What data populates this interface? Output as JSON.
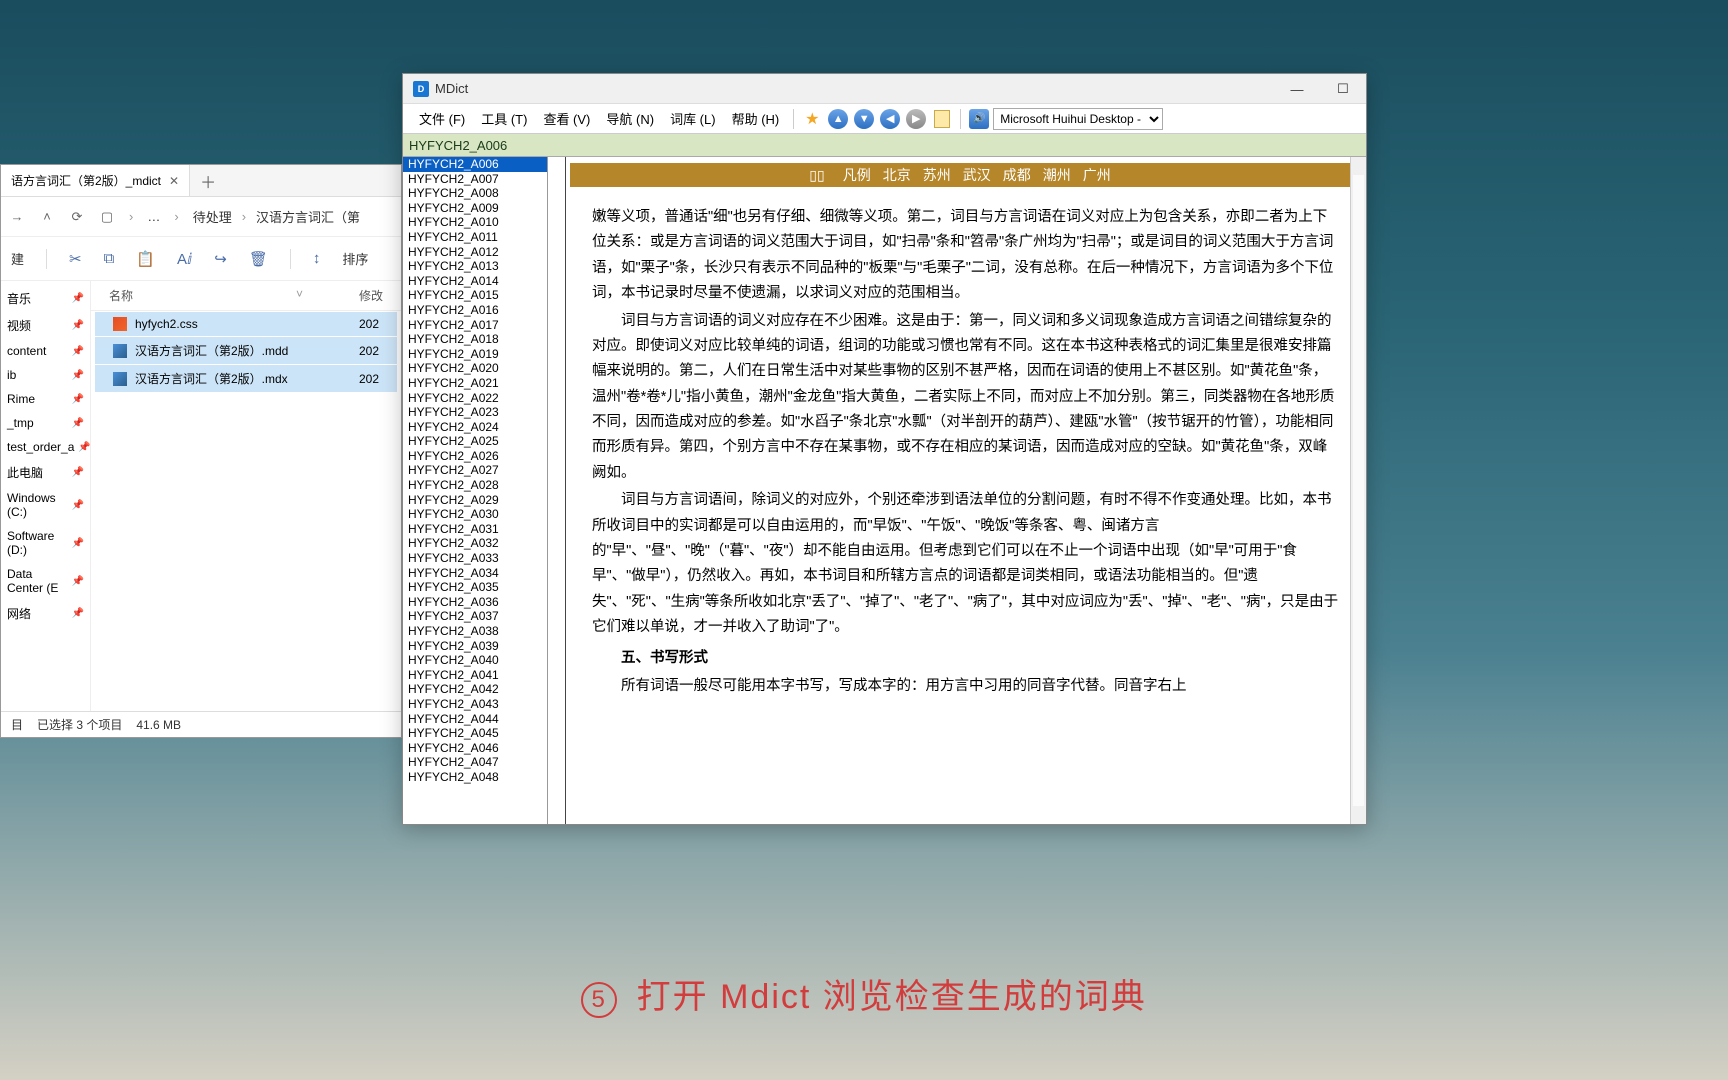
{
  "explorer": {
    "tab_title": "语方言词汇（第2版）_mdict",
    "breadcrumb": {
      "item1": "待处理",
      "item2": "汉语方言词汇（第"
    },
    "new_label": "建",
    "sort_label": "排序",
    "sidebar": {
      "items": [
        "音乐",
        "视频",
        "content",
        "ib",
        "Rime",
        "_tmp",
        "test_order_a",
        "此电脑",
        "Windows (C:)",
        "Software (D:)",
        "Data Center (E",
        "网络"
      ]
    },
    "columns": {
      "name": "名称",
      "date": "修改"
    },
    "files": [
      {
        "name": "hyfych2.css",
        "date": "202",
        "cls": "file-css"
      },
      {
        "name": "汉语方言词汇（第2版）.mdd",
        "date": "202",
        "cls": "file-mdd"
      },
      {
        "name": "汉语方言词汇（第2版）.mdx",
        "date": "202",
        "cls": "file-mdx"
      }
    ],
    "status": {
      "count": "目",
      "sel": "已选择 3 个项目",
      "size": "41.6 MB"
    }
  },
  "mdict": {
    "title": "MDict",
    "menus": [
      "文件 (F)",
      "工具 (T)",
      "查看 (V)",
      "导航 (N)",
      "词库 (L)",
      "帮助 (H)"
    ],
    "tts": "Microsoft Huihui Desktop - C",
    "search": "HYFYCH2_A006",
    "entries": [
      "HYFYCH2_A006",
      "HYFYCH2_A007",
      "HYFYCH2_A008",
      "HYFYCH2_A009",
      "HYFYCH2_A010",
      "HYFYCH2_A011",
      "HYFYCH2_A012",
      "HYFYCH2_A013",
      "HYFYCH2_A014",
      "HYFYCH2_A015",
      "HYFYCH2_A016",
      "HYFYCH2_A017",
      "HYFYCH2_A018",
      "HYFYCH2_A019",
      "HYFYCH2_A020",
      "HYFYCH2_A021",
      "HYFYCH2_A022",
      "HYFYCH2_A023",
      "HYFYCH2_A024",
      "HYFYCH2_A025",
      "HYFYCH2_A026",
      "HYFYCH2_A027",
      "HYFYCH2_A028",
      "HYFYCH2_A029",
      "HYFYCH2_A030",
      "HYFYCH2_A031",
      "HYFYCH2_A032",
      "HYFYCH2_A033",
      "HYFYCH2_A034",
      "HYFYCH2_A035",
      "HYFYCH2_A036",
      "HYFYCH2_A037",
      "HYFYCH2_A038",
      "HYFYCH2_A039",
      "HYFYCH2_A040",
      "HYFYCH2_A041",
      "HYFYCH2_A042",
      "HYFYCH2_A043",
      "HYFYCH2_A044",
      "HYFYCH2_A045",
      "HYFYCH2_A046",
      "HYFYCH2_A047",
      "HYFYCH2_A048"
    ],
    "topbar": [
      "凡例",
      "北京",
      "苏州",
      "武汉",
      "成都",
      "潮州",
      "广州"
    ],
    "body": {
      "p1": "嫩等义项，普通话\"细\"也另有仔细、细微等义项。第二，词目与方言词语在词义对应上为包含关系，亦即二者为上下位关系：或是方言词语的词义范围大于词目，如\"扫帚\"条和\"笤帚\"条广州均为\"扫帚\"；或是词目的词义范围大于方言词语，如\"栗子\"条，长沙只有表示不同品种的\"板栗\"与\"毛栗子\"二词，没有总称。在后一种情况下，方言词语为多个下位词，本书记录时尽量不使遗漏，以求词义对应的范围相当。",
      "p2": "词目与方言词语的词义对应存在不少困难。这是由于：第一，同义词和多义词现象造成方言词语之间错综复杂的对应。即使词义对应比较单纯的词语，组词的功能或习惯也常有不同。这在本书这种表格式的词汇集里是很难安排篇幅来说明的。第二，人们在日常生活中对某些事物的区别不甚严格，因而在词语的使用上不甚区别。如\"黄花鱼\"条，温州\"卷*卷*儿\"指小黄鱼，潮州\"金龙鱼\"指大黄鱼，二者实际上不同，而对应上不加分别。第三，同类器物在各地形质不同，因而造成对应的参差。如\"水舀子\"条北京\"水瓢\"（对半剖开的葫芦）、建瓯\"水管\"（按节锯开的竹管），功能相同而形质有异。第四，个别方言中不存在某事物，或不存在相应的某词语，因而造成对应的空缺。如\"黄花鱼\"条，双峰阙如。",
      "p3": "词目与方言词语间，除词义的对应外，个别还牵涉到语法单位的分割问题，有时不得不作变通处理。比如，本书所收词目中的实词都是可以自由运用的，而\"早饭\"、\"午饭\"、\"晚饭\"等条客、粤、闽诸方言的\"早\"、\"昼\"、\"晚\"（\"暮\"、\"夜\"）却不能自由运用。但考虑到它们可以在不止一个词语中出现（如\"早\"可用于\"食早\"、\"做早\"），仍然收入。再如，本书词目和所辖方言点的词语都是词类相同，或语法功能相当的。但\"遗失\"、\"死\"、\"生病\"等条所收如北京\"丢了\"、\"掉了\"、\"老了\"、\"病了\"，其中对应词应为\"丢\"、\"掉\"、\"老\"、\"病\"，只是由于它们难以单说，才一并收入了助词\"了\"。",
      "h5": "五、书写形式",
      "p4": "所有词语一般尽可能用本字书写，写成本字的：用方言中习用的同音字代替。同音字右上"
    }
  },
  "caption": {
    "num": "5",
    "text": " 打开 Mdict 浏览检查生成的词典"
  }
}
